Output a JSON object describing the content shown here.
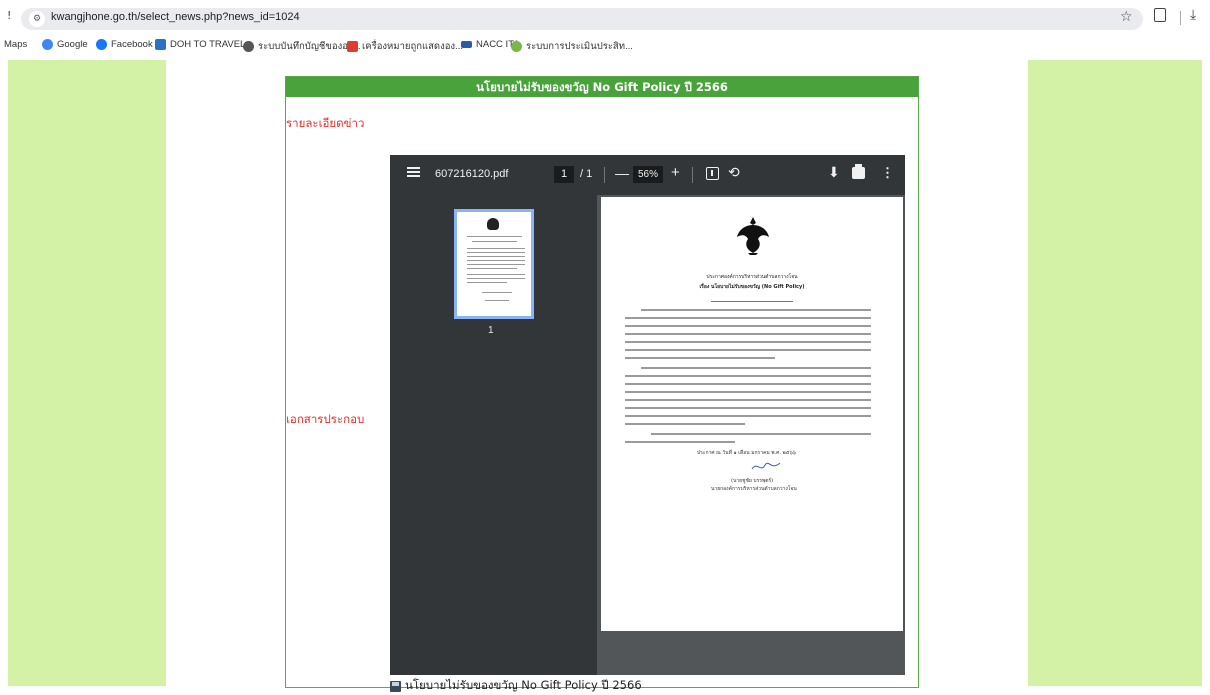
{
  "browser": {
    "url": "kwangjhone.go.th/select_news.php?news_id=1024",
    "edge_glyph": "!",
    "site_info_glyph": "⚙"
  },
  "bookmarks": [
    {
      "label": "Maps",
      "color": ""
    },
    {
      "label": "Google",
      "color": "#4285f4"
    },
    {
      "label": "Facebook",
      "color": "#1877f2"
    },
    {
      "label": "DOH TO TRAVEL",
      "color": "#2a72c8"
    },
    {
      "label": "ระบบบันทึกบัญชีขององ...",
      "color": "#555555"
    },
    {
      "label": "เครื่องหมายถูกแสดงอง...",
      "color": "#e03b2f"
    },
    {
      "label": "NACC ITA",
      "color": "#2a5ca8"
    },
    {
      "label": "ระบบการประเมินประสิท...",
      "color": "#7ab648"
    }
  ],
  "page": {
    "title": "นโยบายไม่รับของขวัญ No Gift Policy ปี 2566",
    "detail_label": "รายละเอียดข่าว",
    "docs_label": "เอกสารประกอบ",
    "attachment_caption": "นโยบายไม่รับของขวัญ No Gift Policy ปี 2566",
    "side_color": "#d3f2a6",
    "title_color": "#4aa23d",
    "label_color": "#e0312b"
  },
  "pdf_viewer": {
    "filename": "607216120.pdf",
    "current_page": "1",
    "page_separator": "/  1",
    "zoom": "56%",
    "zoom_minus": "—",
    "zoom_plus": "+",
    "rotate_glyph": "⟲",
    "download_glyph": "⬇",
    "more_glyph": "⋮",
    "thumbnail_number": "1",
    "doc_heading_1": "ประกาศองค์การบริหารส่วนตำบลกวางโจน",
    "doc_heading_2": "เรื่อง  นโยบายไม่รับของขวัญ (No Gift Policy)",
    "doc_date": "ประกาศ ณ วันที่ ๑ เดือน มกราคม พ.ศ. ๒๕๖๖",
    "doc_signer": "(นายชูชัย  บรรพุตร์)",
    "doc_signer_title": "นายกองค์การบริหารส่วนตำบลกวางโจน"
  }
}
